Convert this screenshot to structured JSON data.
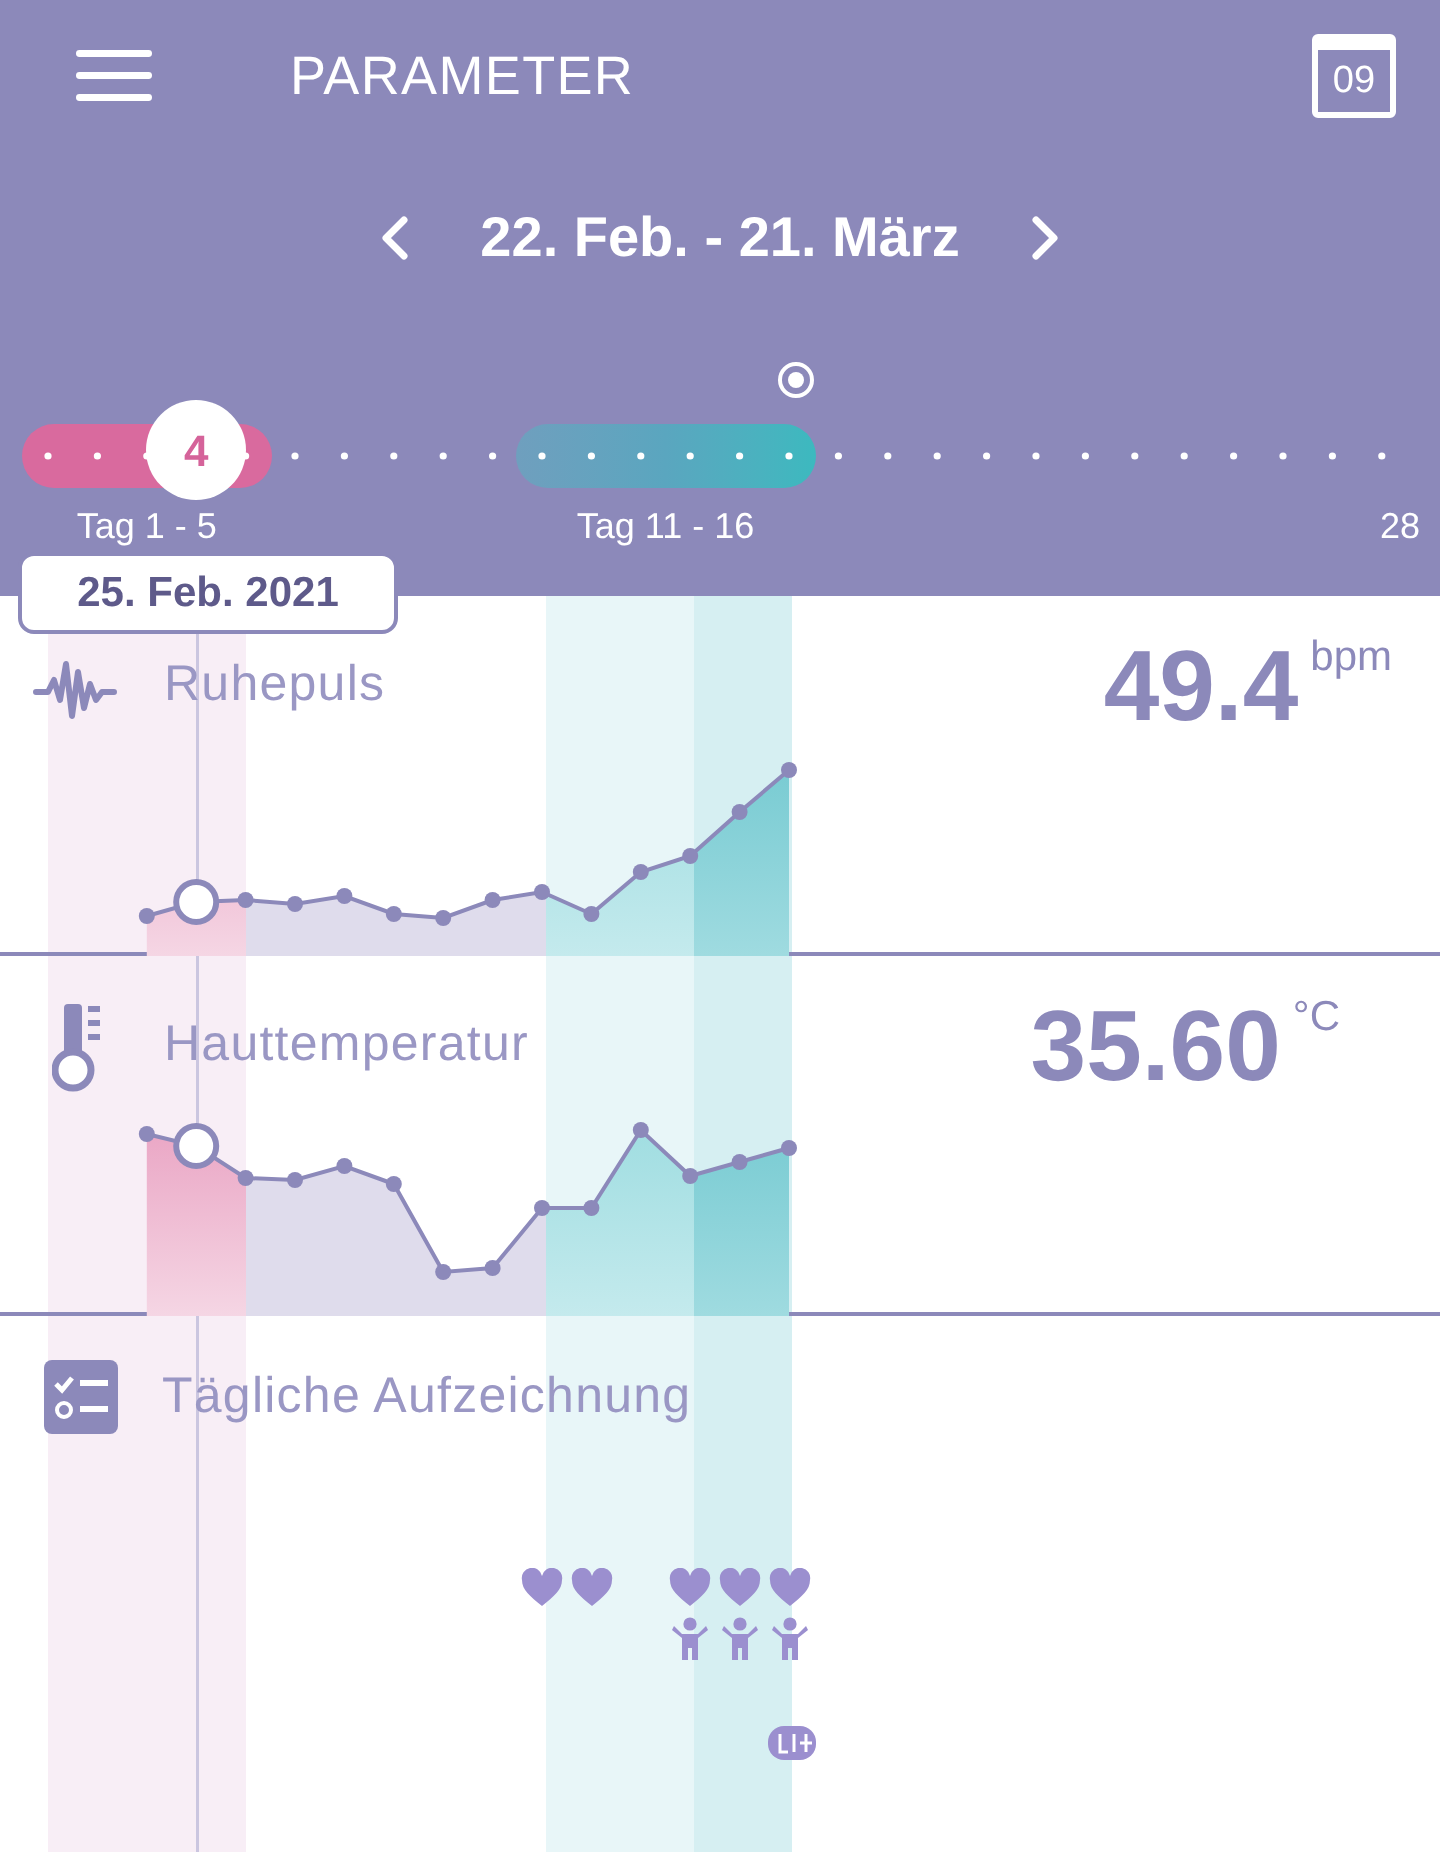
{
  "header": {
    "title": "PARAMETER",
    "calendar_day": "09",
    "date_range": "22. Feb. - 21. März"
  },
  "cycle": {
    "phases": [
      {
        "kind": "period",
        "label": "Tag 1 - 5"
      },
      {
        "kind": "fertile",
        "label": "Tag 11 - 16"
      }
    ],
    "selected_day": "4",
    "end_label": "28",
    "tooltip": "25. Feb. 2021"
  },
  "metrics": [
    {
      "kind": "pulse",
      "label": "Ruhepuls",
      "value": "49.4",
      "unit": "bpm"
    },
    {
      "kind": "temperature",
      "label": "Hauttemperatur",
      "value": "35.60",
      "unit": "°C"
    }
  ],
  "daily_log": {
    "label": "Tägliche Aufzeichnung"
  }
}
